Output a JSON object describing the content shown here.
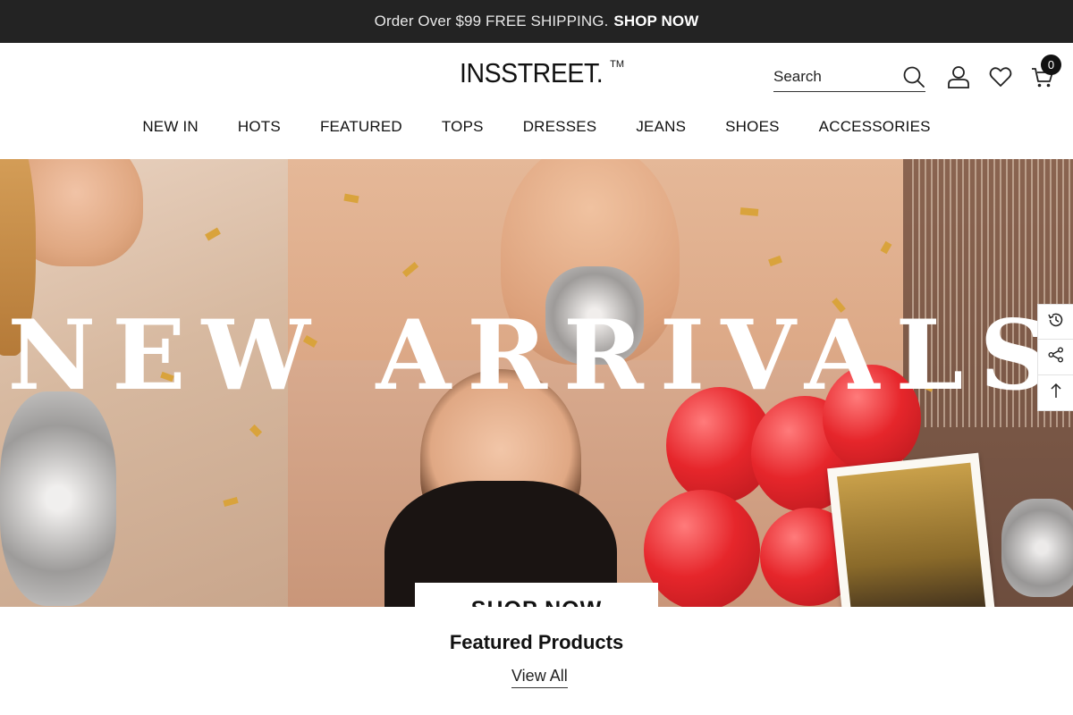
{
  "announcement": {
    "message": "Order Over $99 FREE SHIPPING.",
    "cta": "SHOP NOW"
  },
  "header": {
    "logo_text": "INSSTREET.",
    "logo_tm": "TM",
    "search_placeholder": "Search",
    "cart_count": "0",
    "icons": {
      "search": "search-icon",
      "account": "user-icon",
      "wishlist": "heart-icon",
      "cart": "cart-icon"
    }
  },
  "nav": {
    "items": [
      {
        "label": "NEW IN"
      },
      {
        "label": "HOTS"
      },
      {
        "label": "FEATURED"
      },
      {
        "label": "TOPS"
      },
      {
        "label": "DRESSES"
      },
      {
        "label": "JEANS"
      },
      {
        "label": "SHOES"
      },
      {
        "label": "ACCESSORIES"
      }
    ]
  },
  "hero": {
    "title": "NEW ARRIVALS",
    "button": "SHOP NOW"
  },
  "sidetools": {
    "icons": [
      "history-icon",
      "share-icon",
      "arrow-up-icon"
    ]
  },
  "featured": {
    "title": "Featured Products",
    "view_all": "View All"
  },
  "colors": {
    "announcement_bg": "#232323",
    "balloon_red": "#e6262b",
    "confetti_gold": "#d9a33c"
  }
}
